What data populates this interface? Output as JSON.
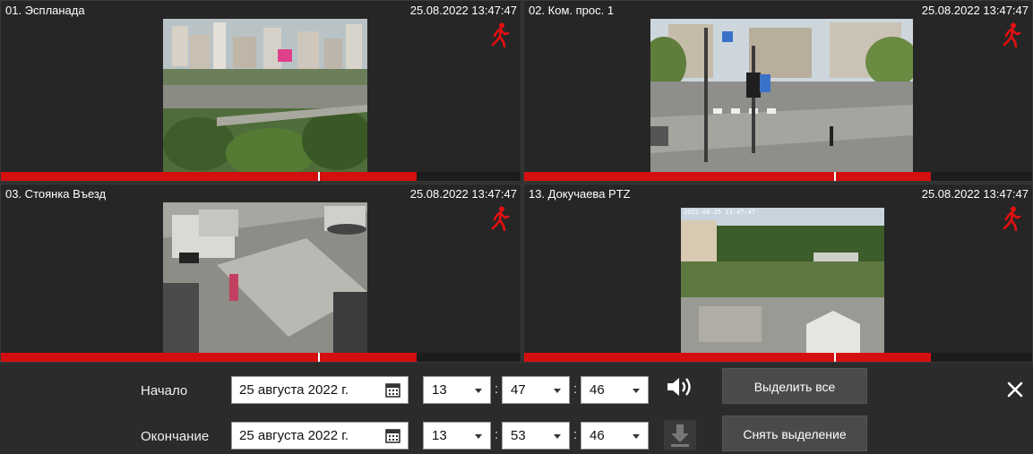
{
  "cameras": [
    {
      "name": "01. Эспланада",
      "time": "25.08.2022 13:47:47"
    },
    {
      "name": "02. Ком. прос. 1",
      "time": "25.08.2022 13:47:47"
    },
    {
      "name": "03. Стоянка Въезд",
      "time": "25.08.2022 13:47:47"
    },
    {
      "name": "13. Докучаева PTZ",
      "time": "25.08.2022 13:47:47"
    }
  ],
  "camera4_overlay": "2022-08-25 13:47:47",
  "timeline": {
    "recorded_fraction": 0.8,
    "playhead_fraction": 0.61
  },
  "controls": {
    "start": {
      "label": "Начало",
      "date": "25 августа 2022 г.",
      "hour": "13",
      "minute": "47",
      "second": "46"
    },
    "end": {
      "label": "Окончание",
      "date": "25 августа 2022 г.",
      "hour": "13",
      "minute": "53",
      "second": "46"
    },
    "time_separator": ":",
    "select_all": "Выделить все",
    "deselect": "Снять выделение"
  },
  "icons": {
    "motion": "motion-person-icon",
    "calendar": "calendar-icon",
    "sound": "speaker-icon",
    "download": "download-icon",
    "close": "close-icon"
  },
  "colors": {
    "accent_red": "#d40f0f",
    "background": "#2b2b2b"
  }
}
